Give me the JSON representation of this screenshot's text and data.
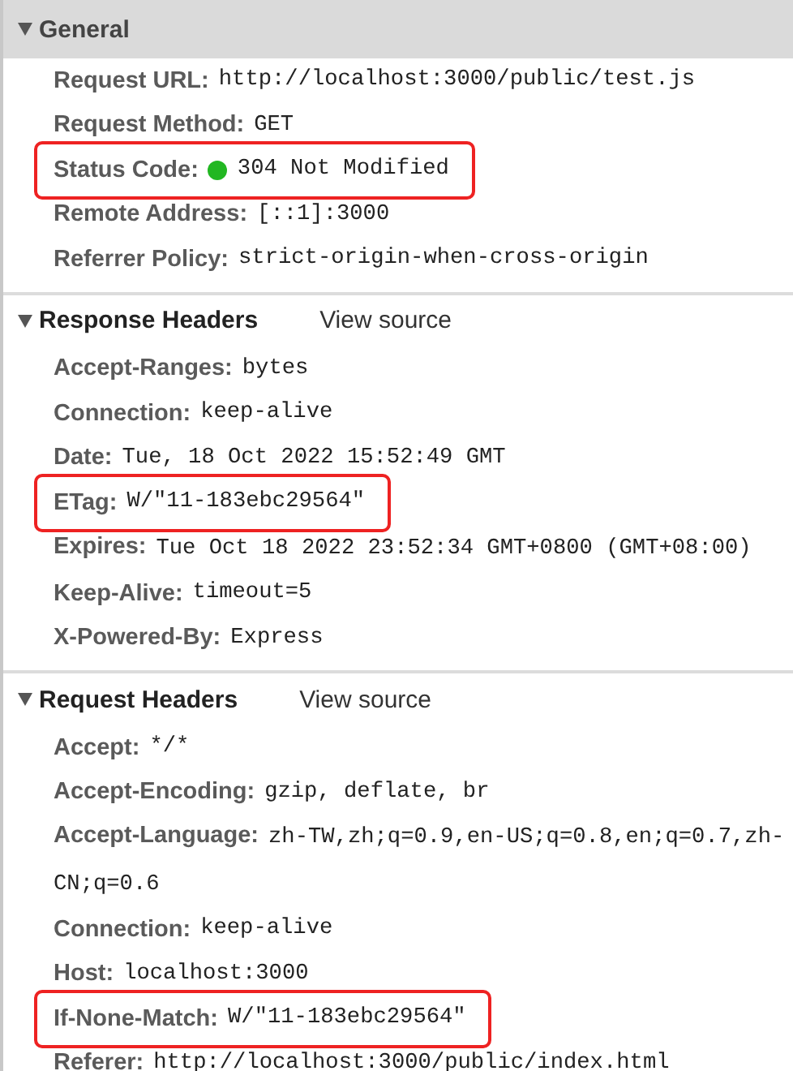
{
  "sections": [
    {
      "title": "General",
      "expanded": true,
      "focused": true,
      "rows": [
        {
          "label": "Request URL:",
          "value": "http://localhost:3000/public/test.js",
          "highlighted": false
        },
        {
          "label": "Request Method:",
          "value": "GET",
          "highlighted": false
        },
        {
          "label": "Status Code:",
          "value": "304 Not Modified",
          "highlighted": true,
          "color": "#22b722"
        },
        {
          "label": "Remote Address:",
          "value": "[::1]:3000",
          "highlighted": false
        },
        {
          "label": "Referrer Policy:",
          "value": "strict-origin-when-cross-origin",
          "highlighted": false
        }
      ]
    },
    {
      "title": "Response Headers",
      "link": "View source",
      "expanded": true,
      "focused": false,
      "rows": [
        {
          "label": "Accept-Ranges:",
          "value": "bytes",
          "highlighted": false
        },
        {
          "label": "Connection:",
          "value": "keep-alive",
          "highlighted": false
        },
        {
          "label": "Date:",
          "value": "Tue, 18 Oct 2022 15:52:49 GMT",
          "highlighted": false
        },
        {
          "label": "ETag:",
          "value": "W/\"11-183ebc29564\"",
          "highlighted": true
        },
        {
          "label": "Expires:",
          "value": "Tue Oct 18 2022 23:52:34 GMT+0800 (GMT+08:00)",
          "highlighted": false
        },
        {
          "label": "Keep-Alive:",
          "value": "timeout=5",
          "highlighted": false
        },
        {
          "label": "X-Powered-By:",
          "value": "Express",
          "highlighted": false
        }
      ]
    },
    {
      "title": "Request Headers",
      "link": "View source",
      "expanded": true,
      "focused": false,
      "rows": [
        {
          "label": "Accept:",
          "value": "*/*",
          "highlighted": false
        },
        {
          "label": "Accept-Encoding:",
          "value": "gzip, deflate, br",
          "highlighted": false
        },
        {
          "label": "Accept-Language:",
          "value": "zh-TW,zh;q=0.9,en-US;q=0.8,en;q=0.7,zh-CN;q=0.6",
          "highlighted": false
        },
        {
          "label": "Connection:",
          "value": "keep-alive",
          "highlighted": false
        },
        {
          "label": "Host:",
          "value": "localhost:3000",
          "highlighted": false
        },
        {
          "label": "If-None-Match:",
          "value": "W/\"11-183ebc29564\"",
          "highlighted": true
        },
        {
          "label": "Referer:",
          "value": "http://localhost:3000/public/index.html",
          "highlighted": false
        }
      ]
    }
  ]
}
